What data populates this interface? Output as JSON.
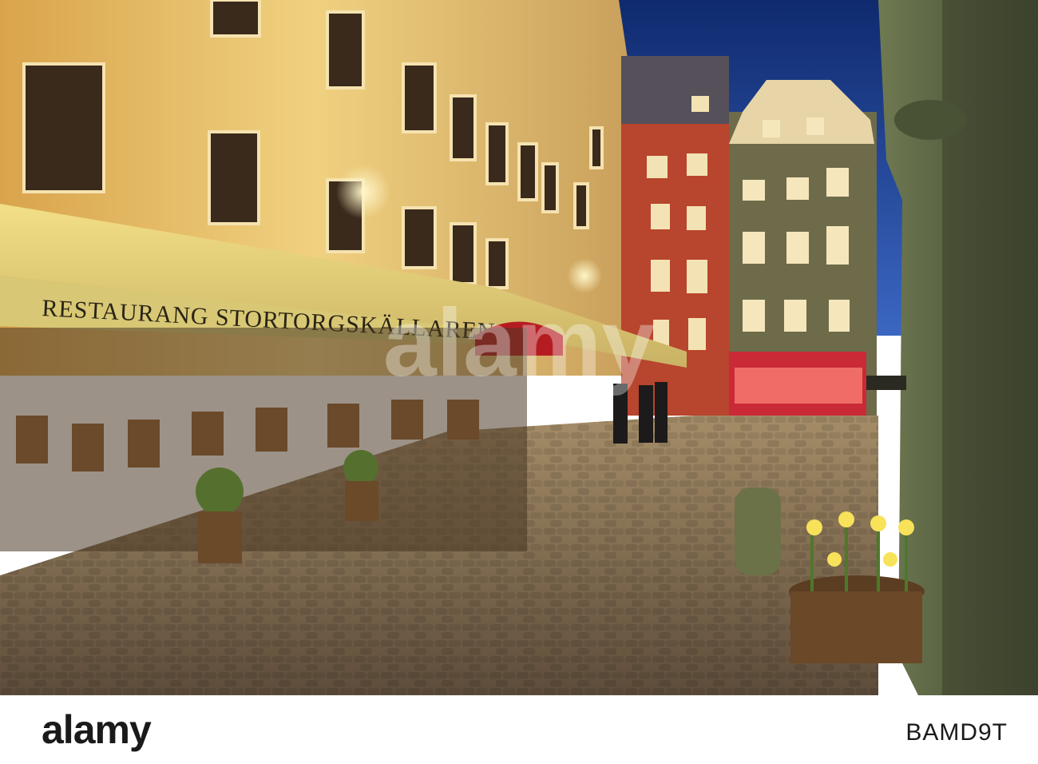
{
  "photo": {
    "description_colors": {
      "sky": "#1a3d8c",
      "awning": "#e8d070",
      "facade_warm": "#e2b85a",
      "facade_red": "#b8402a",
      "facade_green": "#6e6a48",
      "cobblestone": "#8a7660"
    },
    "awning_sign": "RESTAURANG STORTORGSKÄLLAREN",
    "watermark": "alamy"
  },
  "stock_bar": {
    "logo": "alamy",
    "image_id": "BAMD9T"
  }
}
